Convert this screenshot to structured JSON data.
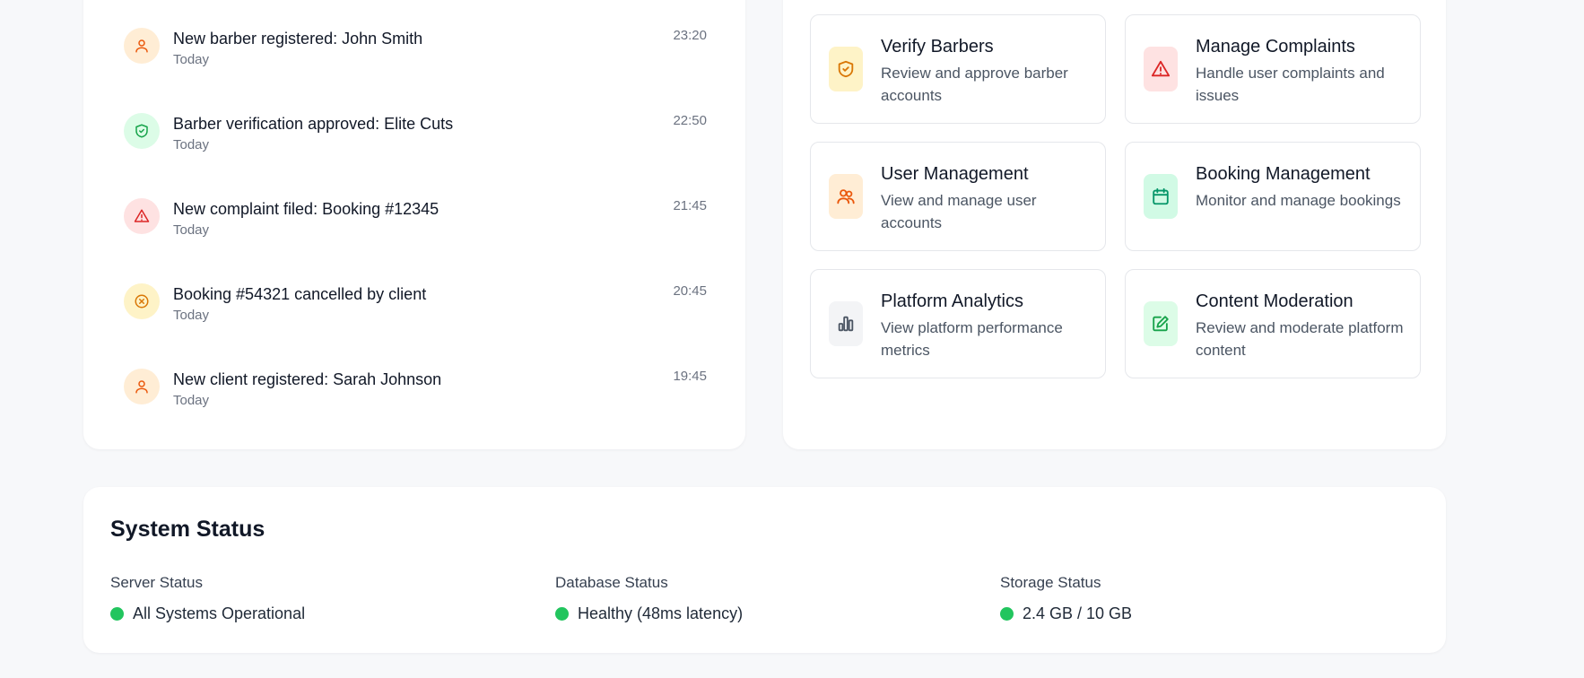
{
  "activity": {
    "items": [
      {
        "text": "New barber registered: John Smith",
        "day": "Today",
        "time": "23:20",
        "icon": "user-icon",
        "bg": "#ffedd5",
        "fg": "#ea580c"
      },
      {
        "text": "Barber verification approved: Elite Cuts",
        "day": "Today",
        "time": "22:50",
        "icon": "shield-check-icon",
        "bg": "#dcfce7",
        "fg": "#16a34a"
      },
      {
        "text": "New complaint filed: Booking #12345",
        "day": "Today",
        "time": "21:45",
        "icon": "alert-triangle-icon",
        "bg": "#fee2e2",
        "fg": "#dc2626"
      },
      {
        "text": "Booking #54321 cancelled by client",
        "day": "Today",
        "time": "20:45",
        "icon": "x-circle-icon",
        "bg": "#fef3c7",
        "fg": "#d97706"
      },
      {
        "text": "New client registered: Sarah Johnson",
        "day": "Today",
        "time": "19:45",
        "icon": "user-icon",
        "bg": "#ffedd5",
        "fg": "#ea580c"
      }
    ]
  },
  "quick_actions": {
    "tiles": [
      {
        "title": "Verify Barbers",
        "description": "Review and approve barber accounts",
        "icon": "shield-check-icon",
        "bg": "#fef3c7",
        "fg": "#d97706"
      },
      {
        "title": "Manage Complaints",
        "description": "Handle user complaints and issues",
        "icon": "alert-triangle-icon",
        "bg": "#fee2e2",
        "fg": "#dc2626"
      },
      {
        "title": "User Management",
        "description": "View and manage user accounts",
        "icon": "users-icon",
        "bg": "#ffedd5",
        "fg": "#ea580c"
      },
      {
        "title": "Booking Management",
        "description": "Monitor and manage bookings",
        "icon": "calendar-icon",
        "bg": "#d1fae5",
        "fg": "#059669"
      },
      {
        "title": "Platform Analytics",
        "description": "View platform performance metrics",
        "icon": "bar-chart-icon",
        "bg": "#f3f4f6",
        "fg": "#4b5563"
      },
      {
        "title": "Content Moderation",
        "description": "Review and moderate platform content",
        "icon": "edit-icon",
        "bg": "#dcfce7",
        "fg": "#16a34a"
      }
    ]
  },
  "system_status": {
    "title": "System Status",
    "server": {
      "label": "Server Status",
      "value": "All Systems Operational",
      "color": "#22c55e"
    },
    "database": {
      "label": "Database Status",
      "value": "Healthy (48ms latency)",
      "color": "#22c55e"
    },
    "storage": {
      "label": "Storage Status",
      "value": "2.4 GB / 10 GB",
      "color": "#22c55e"
    }
  }
}
